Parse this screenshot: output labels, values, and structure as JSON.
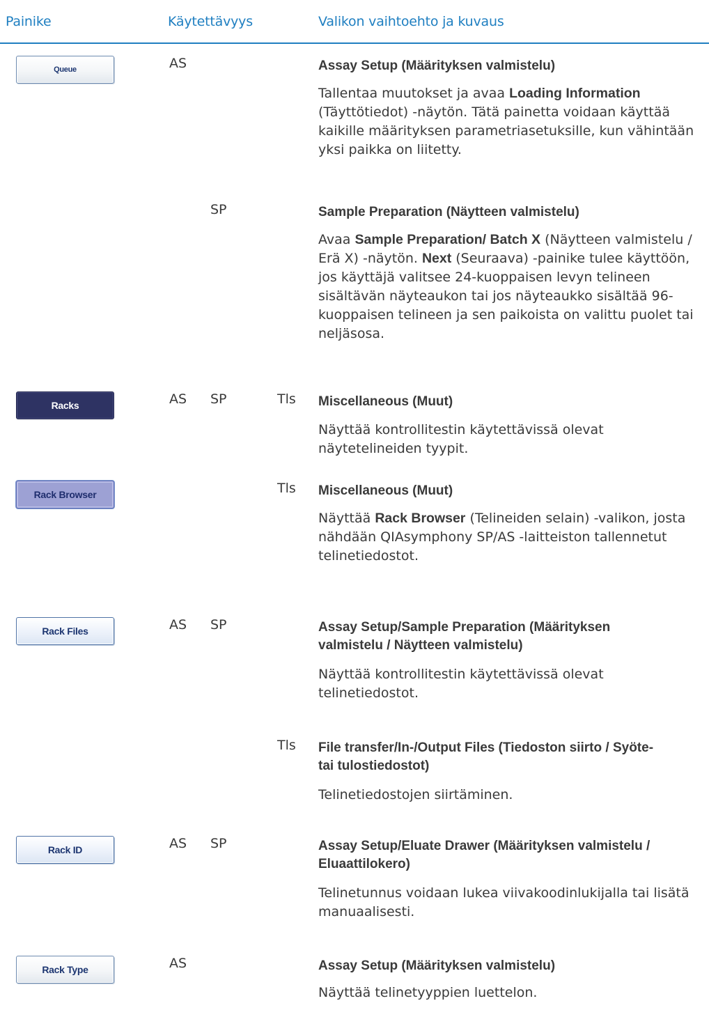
{
  "header": {
    "col_button": "Painike",
    "col_availability": "Käytettävyys",
    "col_option": "Valikon vaihtoehto ja kuvaus"
  },
  "rows": [
    {
      "button_label": "Queue",
      "as": "AS",
      "title": "Assay Setup (Määrityksen valmistelu)",
      "desc": {
        "p1": "Tallentaa muutokset ja avaa ",
        "b1": "Loading Information",
        "p2": " (Täyttötiedot) -näytön. Tätä painetta voidaan käyttää kaikille määrityksen parametriasetuksille, kun vähintään yksi paikka on liitetty."
      }
    },
    {
      "sp": "SP",
      "title": "Sample Preparation (Näytteen valmistelu)",
      "desc": {
        "p1": "Avaa ",
        "b1": "Sample Preparation/ Batch X",
        "p2": " (Näytteen valmistelu / Erä X) -näytön. ",
        "b2": "Next",
        "p3": " (Seuraava) -painike tulee käyttöön, jos käyttäjä valitsee 24-kuoppaisen levyn telineen sisältävän näyteaukon tai jos näyteaukko sisältää 96-kuoppaisen telineen ja sen paikoista on valittu puolet tai neljäsosa."
      }
    },
    {
      "button_label": "Racks",
      "as": "AS",
      "sp": "SP",
      "tls": "Tls",
      "title": "Miscellaneous (Muut)",
      "desc": {
        "p1": "Näyttää kontrollitestin käytettävissä olevat näytetelineiden tyypit."
      }
    },
    {
      "button_label": "Rack Browser",
      "tls": "Tls",
      "title": "Miscellaneous (Muut)",
      "desc": {
        "p1": "Näyttää ",
        "b1": "Rack Browser",
        "p2": " (Telineiden selain) -valikon, josta nähdään QIAsymphony SP/AS -laitteiston tallennetut telinetiedostot."
      }
    },
    {
      "button_label": "Rack Files",
      "as": "AS",
      "sp": "SP",
      "title": "Assay Setup/Sample Preparation (Määrityksen valmistelu / Näytteen valmistelu)",
      "desc": {
        "p1": "Näyttää kontrollitestin käytettävissä olevat telinetiedostot."
      }
    },
    {
      "tls": "Tls",
      "title": "File transfer/In-/Output Files (Tiedoston siirto / Syöte- tai tulostiedostot)",
      "desc": {
        "p1": "Telinetiedostojen siirtäminen."
      }
    },
    {
      "button_label": "Rack ID",
      "as": "AS",
      "sp": "SP",
      "title": "Assay Setup/Eluate Drawer (Määrityksen valmistelu / Eluaattilokero)",
      "desc": {
        "p1": "Telinetunnus voidaan lukea viivakoodinlukijalla tai lisätä manuaalisesti."
      }
    },
    {
      "button_label": "Rack Type",
      "as": "AS",
      "title": "Assay Setup (Määrityksen valmistelu)",
      "desc": {
        "p1": "Näyttää telinetyyppien luettelon."
      }
    }
  ],
  "colors": {
    "header_blue": "#1f7fc1",
    "text": "#3a3a3a",
    "racks_button": "#2e3363",
    "rack_browser_button": "#9da1d4"
  },
  "icons": []
}
